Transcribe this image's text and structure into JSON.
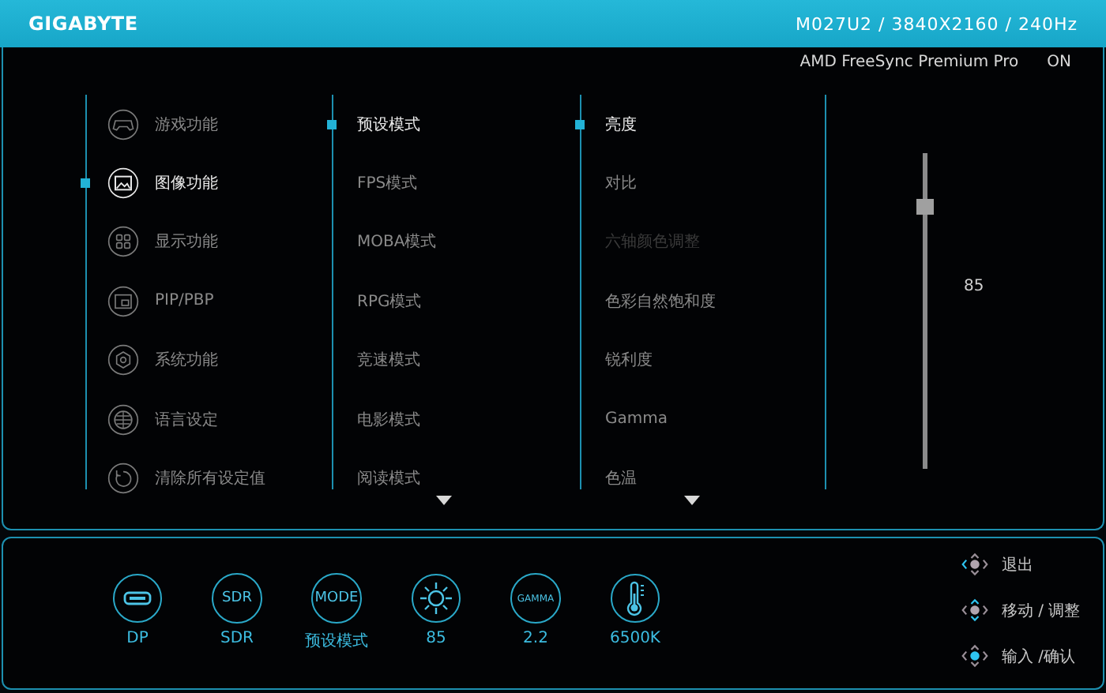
{
  "header": {
    "brand": "GIGABYTE",
    "model_info": "M027U2 / 3840X2160 / 240Hz"
  },
  "freesync": {
    "label": "AMD FreeSync Premium Pro",
    "value": "ON"
  },
  "main_menu": [
    {
      "label": "游戏功能",
      "kind": "gamepad",
      "selected": false
    },
    {
      "label": "图像功能",
      "kind": "picture",
      "selected": true
    },
    {
      "label": "显示功能",
      "kind": "grid",
      "selected": false
    },
    {
      "label": "PIP/PBP",
      "kind": "pip",
      "selected": false
    },
    {
      "label": "系统功能",
      "kind": "gear",
      "selected": false
    },
    {
      "label": "语言设定",
      "kind": "globe",
      "selected": false
    },
    {
      "label": "清除所有设定值",
      "kind": "reset",
      "selected": false
    }
  ],
  "picture_modes": [
    {
      "label": "预设模式",
      "selected": true
    },
    {
      "label": "FPS模式",
      "selected": false
    },
    {
      "label": "MOBA模式",
      "selected": false
    },
    {
      "label": "RPG模式",
      "selected": false
    },
    {
      "label": "竞速模式",
      "selected": false
    },
    {
      "label": "电影模式",
      "selected": false
    },
    {
      "label": "阅读模式",
      "selected": false
    }
  ],
  "settings": [
    {
      "label": "亮度",
      "selected": true,
      "disabled": false
    },
    {
      "label": "对比",
      "selected": false,
      "disabled": false
    },
    {
      "label": "六轴颜色调整",
      "selected": false,
      "disabled": true
    },
    {
      "label": "色彩自然饱和度",
      "selected": false,
      "disabled": false
    },
    {
      "label": "锐利度",
      "selected": false,
      "disabled": false
    },
    {
      "label": "Gamma",
      "selected": false,
      "disabled": false
    },
    {
      "label": "色温",
      "selected": false,
      "disabled": false
    }
  ],
  "brightness": {
    "level": 0.85,
    "reading": "85"
  },
  "status": [
    {
      "kind": "port",
      "label": "DP"
    },
    {
      "kind": "text",
      "icon_text": "SDR",
      "label": "SDR"
    },
    {
      "kind": "text",
      "icon_text": "MODE",
      "label": "预设模式"
    },
    {
      "kind": "sun",
      "label": "85"
    },
    {
      "kind": "text",
      "icon_text": "GAMMA",
      "label": "2.2"
    },
    {
      "kind": "thermometer",
      "label": "6500K"
    }
  ],
  "controls": [
    {
      "kind": "left",
      "label": "退出"
    },
    {
      "kind": "updown",
      "label": "移动 / 调整"
    },
    {
      "kind": "center",
      "label": "输入 /确认"
    }
  ]
}
